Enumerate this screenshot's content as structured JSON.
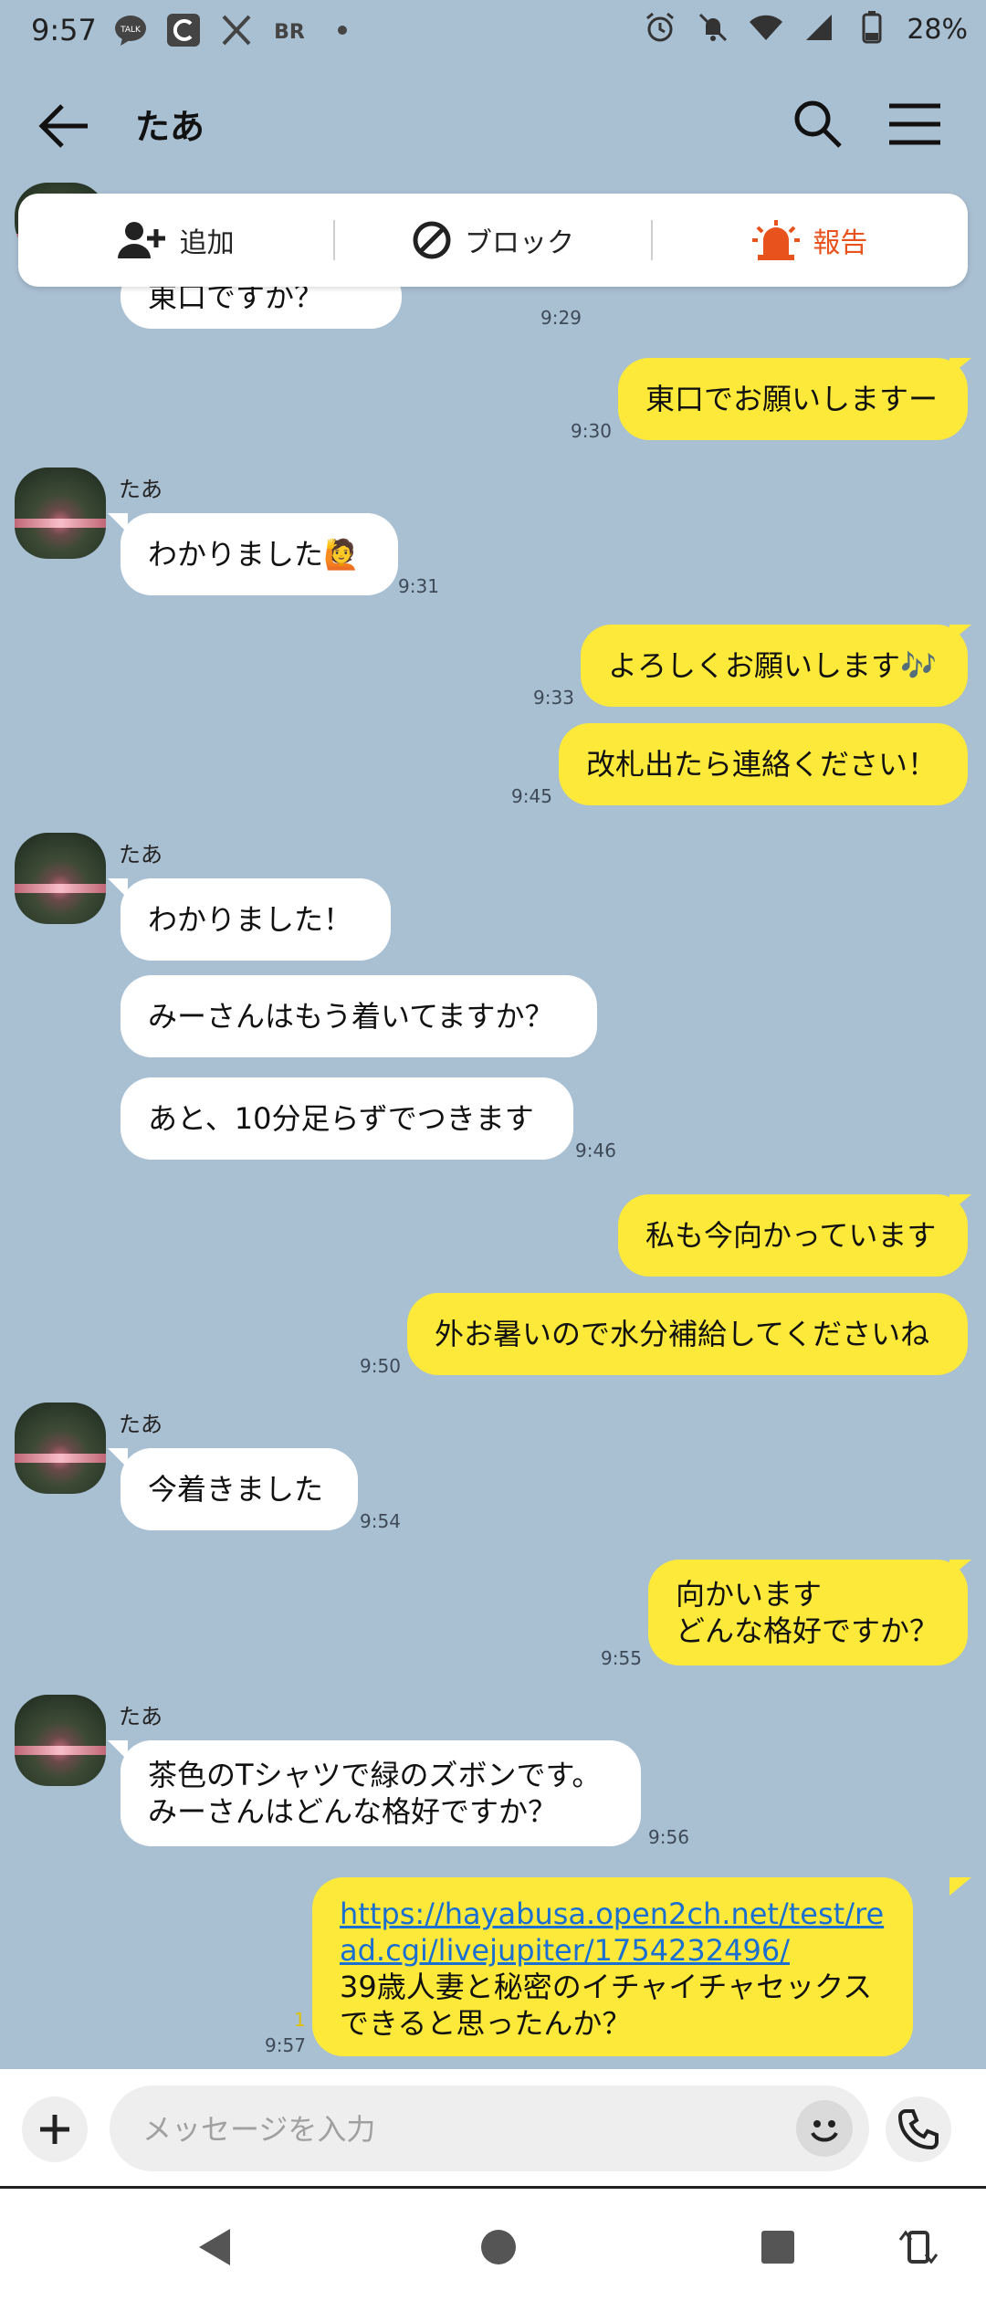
{
  "status_bar": {
    "time": "9:57",
    "left_icons": [
      "talk-icon",
      "c-app-icon",
      "x-icon",
      "br-icon",
      "dot-icon"
    ],
    "battery": "28%"
  },
  "header": {
    "title": "たあ"
  },
  "actions": {
    "add": "追加",
    "block": "ブロック",
    "report": "報告"
  },
  "messages": {
    "partial_text": "東口ですか？",
    "partial_time": "9:29",
    "m1": {
      "text": "東口でお願いしますー",
      "time": "9:30"
    },
    "sender_name": "たあ",
    "m2": {
      "text": "わかりました🙋",
      "time": "9:31"
    },
    "m3": {
      "text": "よろしくお願いします🎶",
      "time": "9:33"
    },
    "m4": {
      "text": "改札出たら連絡ください！",
      "time": "9:45"
    },
    "m5": {
      "text": "わかりました！"
    },
    "m6": {
      "text": "みーさんはもう着いてますか？"
    },
    "m7": {
      "text": "あと、10分足らずでつきます",
      "time": "9:46"
    },
    "m8": {
      "text": "私も今向かっています"
    },
    "m9": {
      "text": "外お暑いので水分補給してくださいね",
      "time": "9:50"
    },
    "m10": {
      "text": "今着きました",
      "time": "9:54"
    },
    "m11": {
      "text": "向かいます\nどんな格好ですか？",
      "time": "9:55"
    },
    "m12": {
      "text": "茶色のTシャツで緑のズボンです。\nみーさんはどんな格好ですか？",
      "time": "9:56"
    },
    "m13": {
      "link": "https://hayabusa.open2ch.net/test/read.cgi/livejupiter/1754232496/",
      "text": "39歳人妻と秘密のイチャイチャセックスできると思ったんか？",
      "read_count": "1",
      "time": "9:57"
    }
  },
  "input": {
    "placeholder": "メッセージを入力"
  },
  "colors": {
    "background": "#a9bfd2",
    "outgoing": "#fde93a",
    "incoming": "#ffffff",
    "report": "#e8531d"
  }
}
